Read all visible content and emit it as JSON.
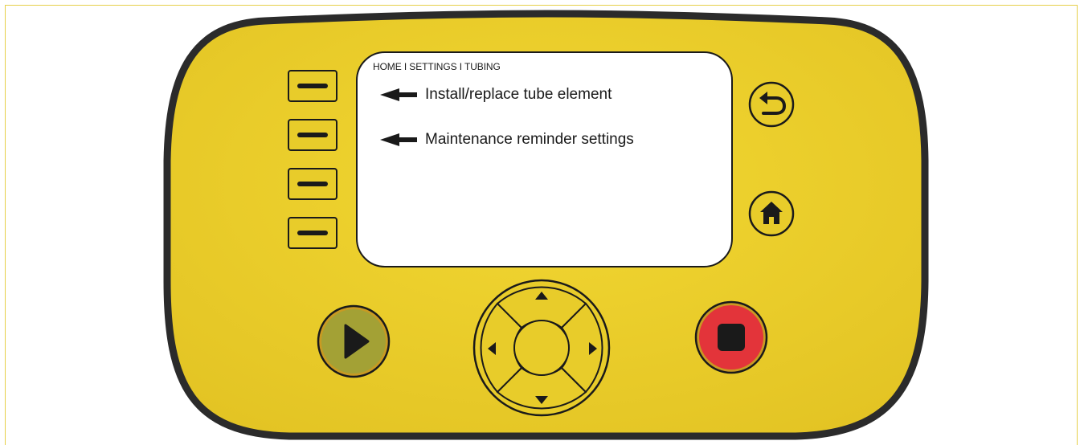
{
  "screen": {
    "breadcrumb": "HOME I SETTINGS I TUBING",
    "menu": [
      {
        "label": "Install/replace tube element"
      },
      {
        "label": "Maintenance reminder settings"
      }
    ]
  },
  "colors": {
    "panel": "#e8cc2a",
    "panel_border": "#2b2b2b",
    "play_button": "#a3a135",
    "stop_button": "#e3343a"
  },
  "icons": {
    "softkeys": "dash-icon",
    "back": "back-arrow-icon",
    "home": "home-icon",
    "play": "play-icon",
    "stop": "stop-icon",
    "dpad": [
      "up-arrow-icon",
      "down-arrow-icon",
      "left-arrow-icon",
      "right-arrow-icon"
    ]
  }
}
